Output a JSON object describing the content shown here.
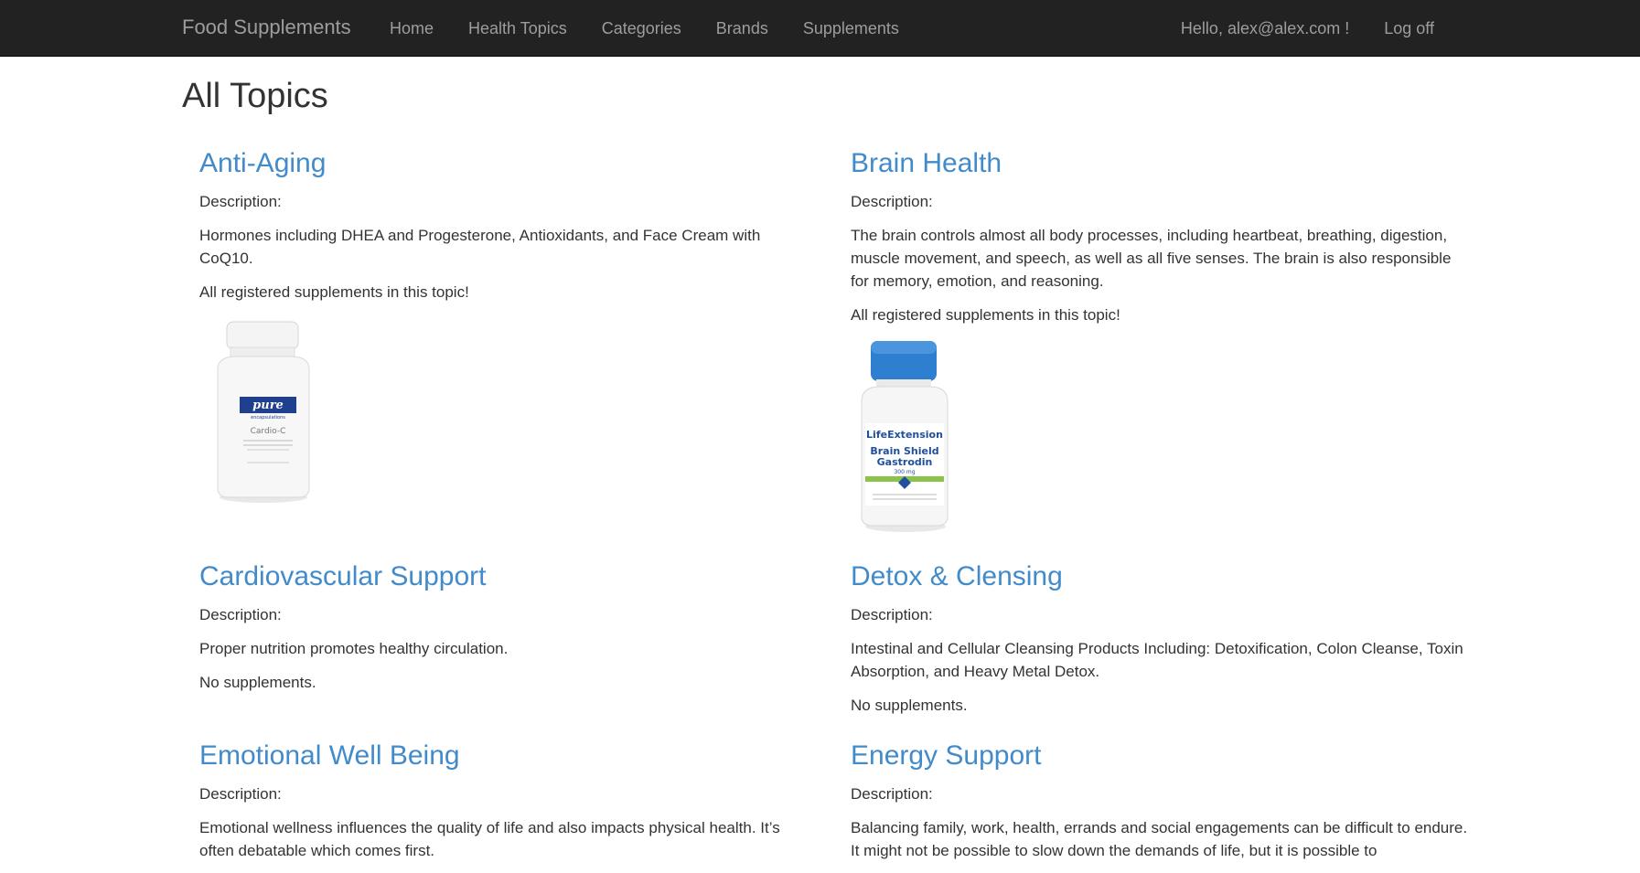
{
  "navbar": {
    "brand": "Food Supplements",
    "links": [
      "Home",
      "Health Topics",
      "Categories",
      "Brands",
      "Supplements"
    ],
    "greeting": "Hello, alex@alex.com !",
    "logoff": "Log off"
  },
  "page": {
    "title": "All Topics"
  },
  "topics": [
    {
      "title": "Anti-Aging",
      "desc_label": "Description:",
      "description": "Hormones including DHEA and Progesterone, Antioxidants, and Face Cream with CoQ10.",
      "supplements_text": "All registered supplements in this topic!",
      "supplement_image": {
        "brand": "pure",
        "subbrand": "encapsulations",
        "product": "Cardio-C"
      }
    },
    {
      "title": "Brain Health",
      "desc_label": "Description:",
      "description": "The brain controls almost all body processes, including heartbeat, breathing, digestion, muscle movement, and speech, as well as all five senses. The brain is also responsible for memory, emotion, and reasoning.",
      "supplements_text": "All registered supplements in this topic!",
      "supplement_image": {
        "brand": "LifeExtension",
        "product": "Brain Shield",
        "product2": "Gastrodin",
        "dose": "300 mg"
      }
    },
    {
      "title": "Cardiovascular Support",
      "desc_label": "Description:",
      "description": "Proper nutrition promotes healthy circulation.",
      "supplements_text": "No supplements."
    },
    {
      "title": "Detox & Clensing",
      "desc_label": "Description:",
      "description": "Intestinal and Cellular Cleansing Products Including: Detoxification, Colon Cleanse, Toxin Absorption, and Heavy Metal Detox.",
      "supplements_text": "No supplements."
    },
    {
      "title": "Emotional Well Being",
      "desc_label": "Description:",
      "description": "Emotional wellness influences the quality of life and also impacts physical health. It’s often debatable which comes first."
    },
    {
      "title": "Energy Support",
      "desc_label": "Description:",
      "description": "Balancing family, work, health, errands and social engagements can be difficult to endure. It might not be possible to slow down the demands of life, but it is possible to"
    }
  ],
  "colors": {
    "navbar_bg": "#222222",
    "nav_text": "#9d9d9d",
    "link": "#428bca",
    "text": "#333333"
  }
}
